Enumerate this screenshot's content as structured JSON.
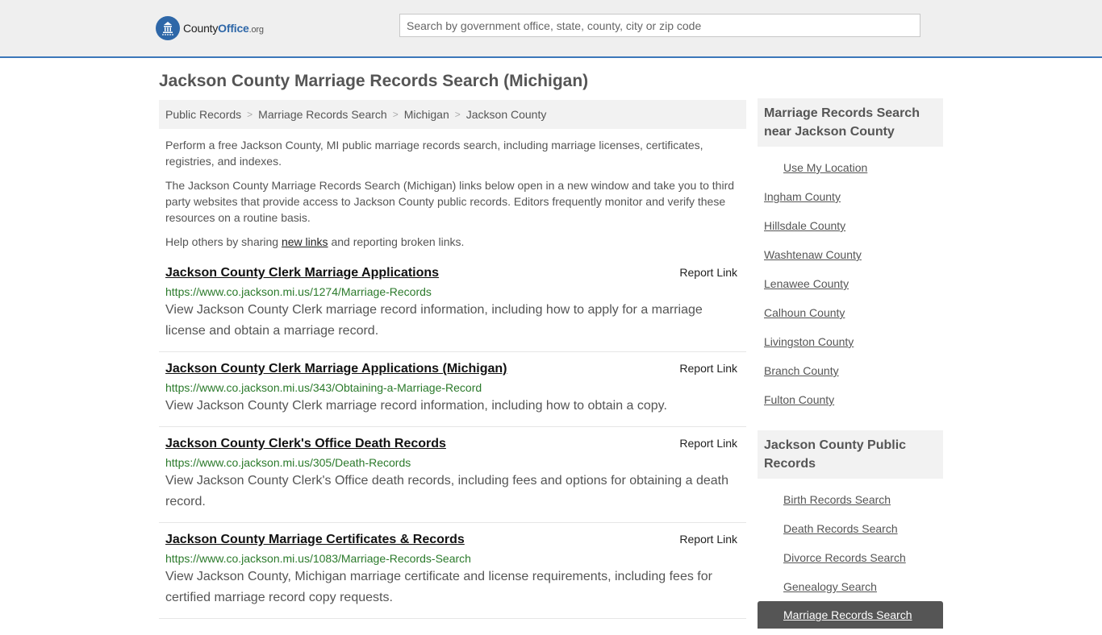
{
  "header": {
    "logo": {
      "part1": "County",
      "part2": "Office",
      "part3": ".org"
    },
    "search_placeholder": "Search by government office, state, county, city or zip code"
  },
  "page_title": "Jackson County Marriage Records Search (Michigan)",
  "breadcrumb": [
    "Public Records",
    "Marriage Records Search",
    "Michigan",
    "Jackson County"
  ],
  "intro": {
    "p1": "Perform a free Jackson County, MI public marriage records search, including marriage licenses, certificates, registries, and indexes.",
    "p2": "The Jackson County Marriage Records Search (Michigan) links below open in a new window and take you to third party websites that provide access to Jackson County public records. Editors frequently monitor and verify these resources on a routine basis.",
    "p3_before": "Help others by sharing ",
    "p3_link": "new links",
    "p3_after": " and reporting broken links."
  },
  "report_label": "Report Link",
  "results": [
    {
      "title": "Jackson County Clerk Marriage Applications",
      "url": "https://www.co.jackson.mi.us/1274/Marriage-Records",
      "desc": "View Jackson County Clerk marriage record information, including how to apply for a marriage license and obtain a marriage record."
    },
    {
      "title": "Jackson County Clerk Marriage Applications (Michigan)",
      "url": "https://www.co.jackson.mi.us/343/Obtaining-a-Marriage-Record",
      "desc": "View Jackson County Clerk marriage record information, including how to obtain a copy."
    },
    {
      "title": "Jackson County Clerk's Office Death Records",
      "url": "https://www.co.jackson.mi.us/305/Death-Records",
      "desc": "View Jackson County Clerk's Office death records, including fees and options for obtaining a death record."
    },
    {
      "title": "Jackson County Marriage Certificates & Records",
      "url": "https://www.co.jackson.mi.us/1083/Marriage-Records-Search",
      "desc": "View Jackson County, Michigan marriage certificate and license requirements, including fees for certified marriage record copy requests."
    }
  ],
  "sidebar": {
    "near_heading": "Marriage Records Search near Jackson County",
    "use_location": "Use My Location",
    "near_counties": [
      "Ingham County",
      "Hillsdale County",
      "Washtenaw County",
      "Lenawee County",
      "Calhoun County",
      "Livingston County",
      "Branch County",
      "Fulton County"
    ],
    "public_heading": "Jackson County Public Records",
    "public_links": [
      "Birth Records Search",
      "Death Records Search",
      "Divorce Records Search",
      "Genealogy Search",
      "Marriage Records Search"
    ]
  },
  "colors": {
    "accent": "#2e67a8",
    "url_green": "#2b7a2b",
    "active_bg": "#555555"
  }
}
